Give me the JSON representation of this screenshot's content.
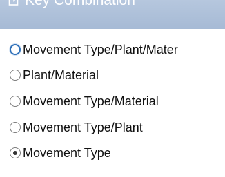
{
  "window": {
    "title": "Key Combination"
  },
  "options": [
    {
      "label": "Movement Type/Plant/Mater",
      "selected": false,
      "focused": true
    },
    {
      "label": "Plant/Material",
      "selected": false,
      "focused": false
    },
    {
      "label": "Movement Type/Material",
      "selected": false,
      "focused": false
    },
    {
      "label": "Movement Type/Plant",
      "selected": false,
      "focused": false
    },
    {
      "label": "Movement Type",
      "selected": true,
      "focused": false
    }
  ],
  "colors": {
    "header": "#b6c7de",
    "focus": "#2d6fb8",
    "text": "#111111"
  },
  "icons": {
    "header": "edit-icon"
  }
}
